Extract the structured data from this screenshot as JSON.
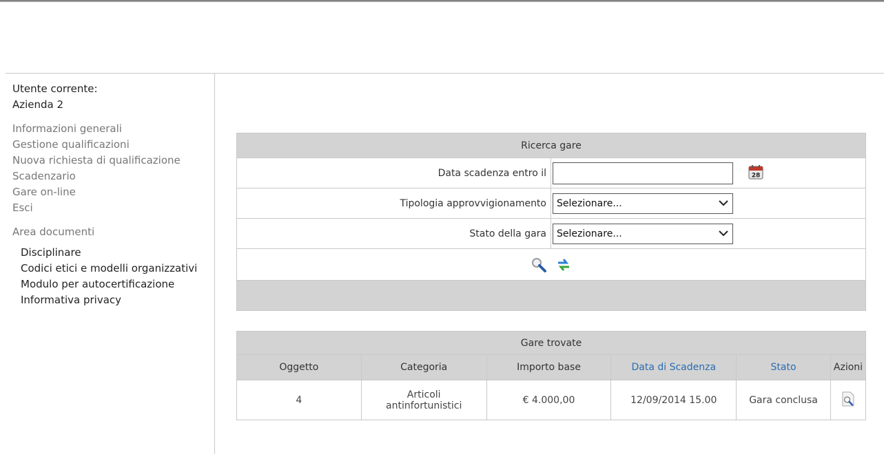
{
  "sidebar": {
    "user_label": "Utente corrente:",
    "user_name": "Azienda 2",
    "nav": [
      "Informazioni generali",
      "Gestione qualificazioni",
      "Nuova richiesta di qualificazione",
      "Scadenzario",
      "Gare on-line",
      "Esci"
    ],
    "docs_heading": "Area documenti",
    "docs": [
      "Disciplinare",
      "Codici etici e modelli organizzativi",
      "Modulo per autocertificazione",
      "Informativa privacy"
    ]
  },
  "search": {
    "title": "Ricerca gare",
    "deadline_label": "Data scadenza entro il",
    "deadline_value": "",
    "calendar_day": "28",
    "type_label": "Tipologia approvvigionamento",
    "type_value": "Selezionare...",
    "status_label": "Stato della gara",
    "status_value": "Selezionare..."
  },
  "results": {
    "title": "Gare trovate",
    "columns": [
      "Oggetto",
      "Categoria",
      "Importo base",
      "Data di Scadenza",
      "Stato",
      "Azioni"
    ],
    "rows": [
      {
        "oggetto": "4",
        "categoria": "Articoli antinfortunistici",
        "importo": "€ 4.000,00",
        "scadenza": "12/09/2014 15.00",
        "stato": "Gara conclusa"
      }
    ]
  },
  "colors": {
    "band": "#d3d3d3",
    "link": "#2a6cb0",
    "muted_nav": "#777777"
  }
}
